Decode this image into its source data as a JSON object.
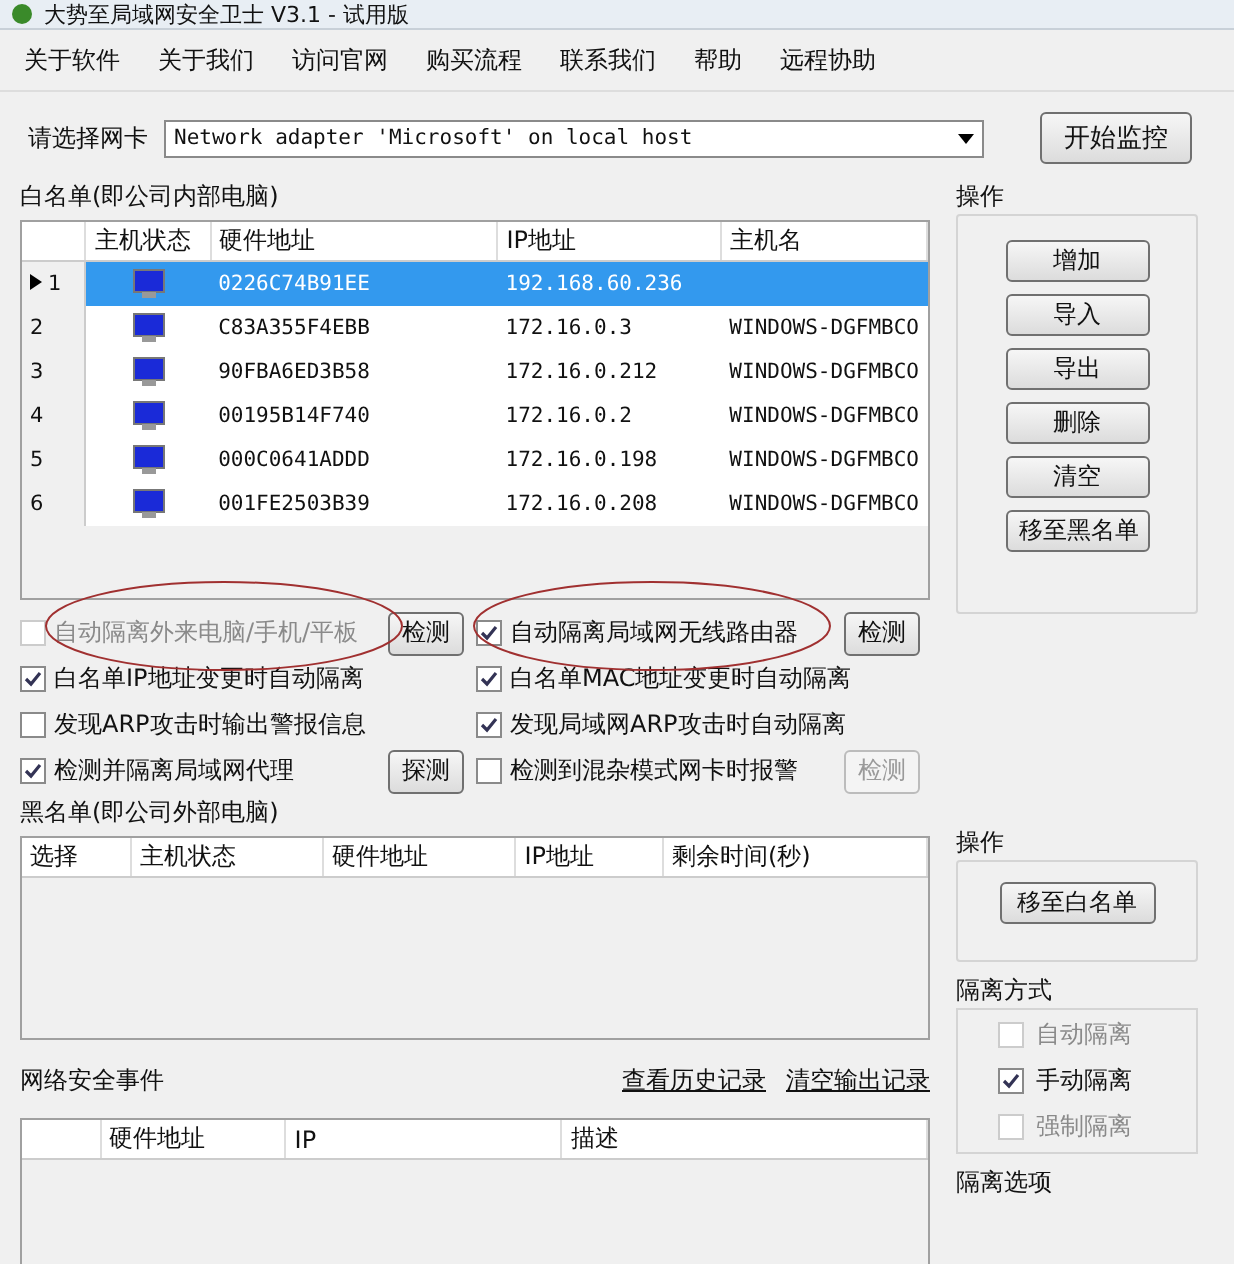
{
  "window": {
    "title": "大势至局域网安全卫士 V3.1 - 试用版"
  },
  "menu": [
    "关于软件",
    "关于我们",
    "访问官网",
    "购买流程",
    "联系我们",
    "帮助",
    "远程协助"
  ],
  "adapter": {
    "label": "请选择网卡",
    "value": "Network adapter 'Microsoft' on local host",
    "button": "开始监控"
  },
  "whitelist": {
    "title": "白名单(即公司内部电脑)",
    "columns": [
      "主机状态",
      "硬件地址",
      "IP地址",
      "主机名"
    ],
    "rows": [
      {
        "no": "1",
        "selected": true,
        "mac": "0226C74B91EE",
        "ip": "192.168.60.236",
        "host": ""
      },
      {
        "no": "2",
        "selected": false,
        "mac": "C83A355F4EBB",
        "ip": "172.16.0.3",
        "host": "WINDOWS-DGFMBCO"
      },
      {
        "no": "3",
        "selected": false,
        "mac": "90FBA6ED3B58",
        "ip": "172.16.0.212",
        "host": "WINDOWS-DGFMBCO"
      },
      {
        "no": "4",
        "selected": false,
        "mac": "00195B14F740",
        "ip": "172.16.0.2",
        "host": "WINDOWS-DGFMBCO"
      },
      {
        "no": "5",
        "selected": false,
        "mac": "000C0641ADDD",
        "ip": "172.16.0.198",
        "host": "WINDOWS-DGFMBCO"
      },
      {
        "no": "6",
        "selected": false,
        "mac": "001FE2503B39",
        "ip": "172.16.0.208",
        "host": "WINDOWS-DGFMBCO"
      }
    ]
  },
  "operations": {
    "title": "操作",
    "buttons": [
      "增加",
      "导入",
      "导出",
      "删除",
      "清空",
      "移至黑名单"
    ]
  },
  "options": [
    {
      "label": "自动隔离外来电脑/手机/平板",
      "checked": false,
      "disabled": true,
      "button": "检测",
      "button_disabled": false,
      "circled": true
    },
    {
      "label": "自动隔离局域网无线路由器",
      "checked": true,
      "disabled": false,
      "button": "检测",
      "button_disabled": false,
      "circled": true
    },
    {
      "label": "白名单IP地址变更时自动隔离",
      "checked": true,
      "disabled": false
    },
    {
      "label": "白名单MAC地址变更时自动隔离",
      "checked": true,
      "disabled": false
    },
    {
      "label": "发现ARP攻击时输出警报信息",
      "checked": false,
      "disabled": false
    },
    {
      "label": "发现局域网ARP攻击时自动隔离",
      "checked": true,
      "disabled": false
    },
    {
      "label": "检测并隔离局域网代理",
      "checked": true,
      "disabled": false,
      "button": "探测",
      "button_disabled": false
    },
    {
      "label": "检测到混杂模式网卡时报警",
      "checked": false,
      "disabled": false,
      "button": "检测",
      "button_disabled": true
    }
  ],
  "blacklist": {
    "title": "黑名单(即公司外部电脑)",
    "columns": [
      "选择",
      "主机状态",
      "硬件地址",
      "IP地址",
      "剩余时间(秒)"
    ]
  },
  "blacklist_operations": {
    "title": "操作",
    "button": "移至白名单"
  },
  "isolation_mode": {
    "title": "隔离方式",
    "options": [
      {
        "label": "自动隔离",
        "selected": false,
        "disabled": true
      },
      {
        "label": "手动隔离",
        "selected": true,
        "disabled": false
      },
      {
        "label": "强制隔离",
        "selected": false,
        "disabled": true
      }
    ]
  },
  "events": {
    "title": "网络安全事件",
    "links": [
      "查看历史记录",
      "清空输出记录"
    ],
    "columns": [
      "",
      "硬件地址",
      "IP",
      "描述"
    ]
  },
  "isolation_options": {
    "title": "隔离选项"
  }
}
